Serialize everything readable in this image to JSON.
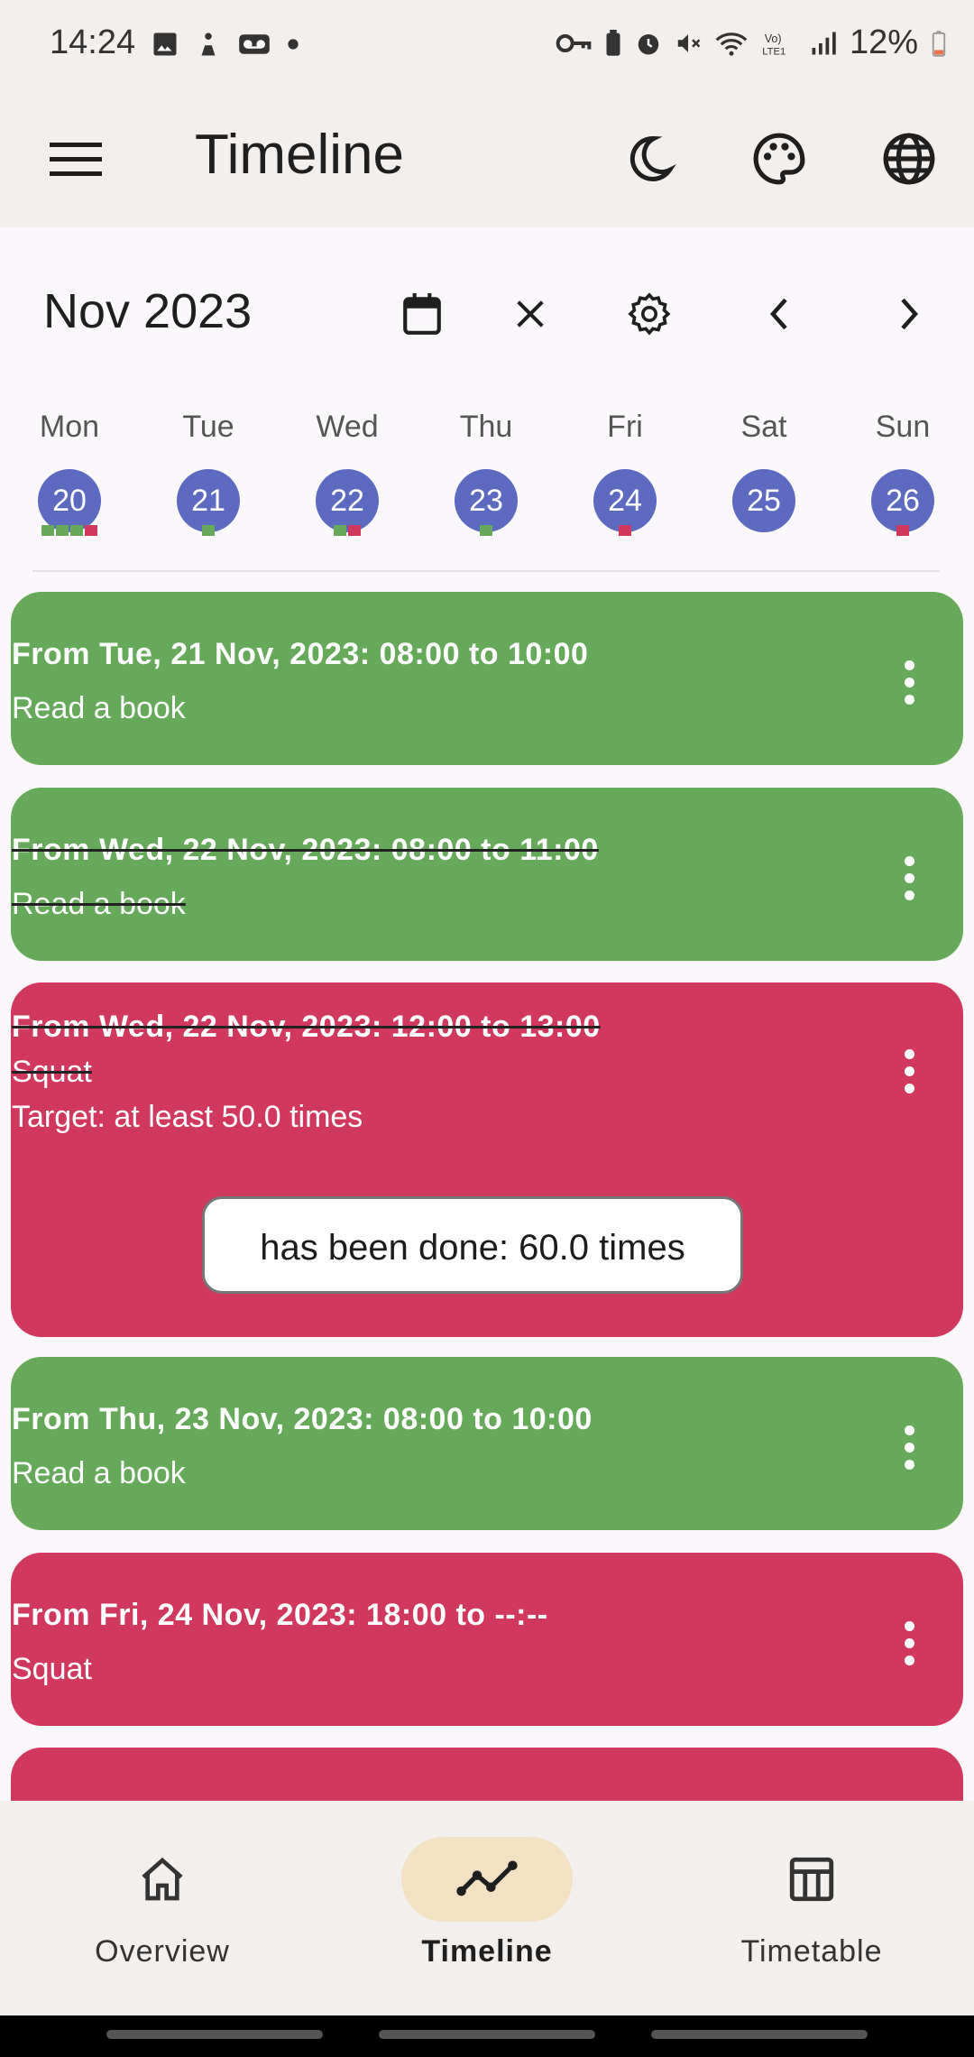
{
  "status_bar": {
    "time": "14:24",
    "battery": "12%",
    "left_icons": [
      "gallery-icon",
      "accessibility-icon",
      "voicemail-icon",
      "dot-icon"
    ],
    "right_icons": [
      "vpn-key-icon",
      "battery-saver-icon",
      "alarm-icon",
      "mute-icon",
      "wifi-icon",
      "volte-icon",
      "signal-icon",
      "battery-icon"
    ]
  },
  "app_bar": {
    "title": "Timeline",
    "actions": [
      "dark-mode-icon",
      "palette-icon",
      "language-icon"
    ]
  },
  "calendar": {
    "month_label": "Nov 2023",
    "tools": [
      "calendar-icon",
      "clear-icon",
      "settings-icon",
      "previous-icon",
      "next-icon"
    ],
    "days": [
      {
        "weekday": "Mon",
        "date": "20",
        "markers": [
          "green",
          "green",
          "green",
          "red"
        ]
      },
      {
        "weekday": "Tue",
        "date": "21",
        "markers": [
          "green"
        ]
      },
      {
        "weekday": "Wed",
        "date": "22",
        "markers": [
          "green",
          "red"
        ]
      },
      {
        "weekday": "Thu",
        "date": "23",
        "markers": [
          "green"
        ]
      },
      {
        "weekday": "Fri",
        "date": "24",
        "markers": [
          "red"
        ]
      },
      {
        "weekday": "Sat",
        "date": "25",
        "markers": []
      },
      {
        "weekday": "Sun",
        "date": "26",
        "markers": [
          "red"
        ]
      }
    ]
  },
  "events": [
    {
      "title": "From Tue, 21 Nov, 2023: 08:00 to 10:00",
      "subtitle": "Read a book",
      "color": "green",
      "done": false
    },
    {
      "title": "From Wed, 22 Nov, 2023: 08:00 to 11:00",
      "subtitle": "Read a book",
      "color": "green",
      "done": true
    },
    {
      "title": "From Wed, 22 Nov, 2023: 12:00 to 13:00",
      "subtitle": "Squat",
      "target": "Target: at least 50.0 times",
      "done_label": "has been done: 60.0 times",
      "color": "red",
      "done": true
    },
    {
      "title": "From Thu, 23 Nov, 2023: 08:00 to 10:00",
      "subtitle": "Read a book",
      "color": "green",
      "done": false
    },
    {
      "title": "From Fri, 24 Nov, 2023: 18:00 to --:--",
      "subtitle": "Squat",
      "color": "red",
      "done": false
    }
  ],
  "colors": {
    "green": "#66A95B",
    "red": "#D1385E",
    "day_circle": "#5C6BC0",
    "nav_active": "#F3E1C4"
  },
  "nav": {
    "items": [
      {
        "label": "Overview",
        "icon": "home-icon"
      },
      {
        "label": "Timeline",
        "icon": "timeline-icon",
        "active": true
      },
      {
        "label": "Timetable",
        "icon": "table-icon"
      }
    ]
  }
}
